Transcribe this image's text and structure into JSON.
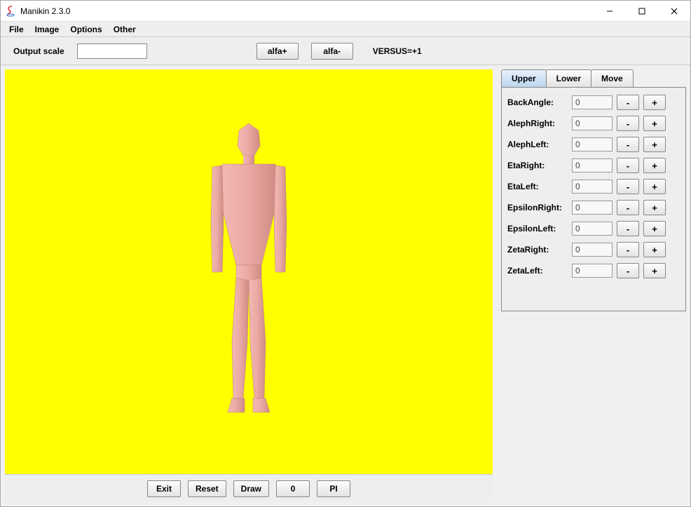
{
  "window": {
    "title": "Manikin 2.3.0"
  },
  "menu": {
    "items": [
      "File",
      "Image",
      "Options",
      "Other"
    ]
  },
  "toolbar": {
    "output_scale_label": "Output scale",
    "output_scale_value": "",
    "alfa_plus": "alfa+",
    "alfa_minus": "alfa-",
    "versus": "VERSUS=+1"
  },
  "tabs": {
    "items": [
      "Upper",
      "Lower",
      "Move"
    ],
    "active_index": 0
  },
  "params": [
    {
      "label": "BackAngle:",
      "value": "0",
      "minus": "-",
      "plus": "+"
    },
    {
      "label": "AlephRight:",
      "value": "0",
      "minus": "-",
      "plus": "+"
    },
    {
      "label": "AlephLeft:",
      "value": "0",
      "minus": "-",
      "plus": "+"
    },
    {
      "label": "EtaRight:",
      "value": "0",
      "minus": "-",
      "plus": "+"
    },
    {
      "label": "EtaLeft:",
      "value": "0",
      "minus": "-",
      "plus": "+"
    },
    {
      "label": "EpsilonRight:",
      "value": "0",
      "minus": "-",
      "plus": "+"
    },
    {
      "label": "EpsilonLeft:",
      "value": "0",
      "minus": "-",
      "plus": "+"
    },
    {
      "label": "ZetaRight:",
      "value": "0",
      "minus": "-",
      "plus": "+"
    },
    {
      "label": "ZetaLeft:",
      "value": "0",
      "minus": "-",
      "plus": "+"
    }
  ],
  "bottom": {
    "exit": "Exit",
    "reset": "Reset",
    "draw": "Draw",
    "zero": "0",
    "pi": "PI"
  },
  "colors": {
    "canvas_bg": "#ffff00",
    "manikin_fill": "#eaa9a4",
    "manikin_shade": "#d18e88"
  }
}
